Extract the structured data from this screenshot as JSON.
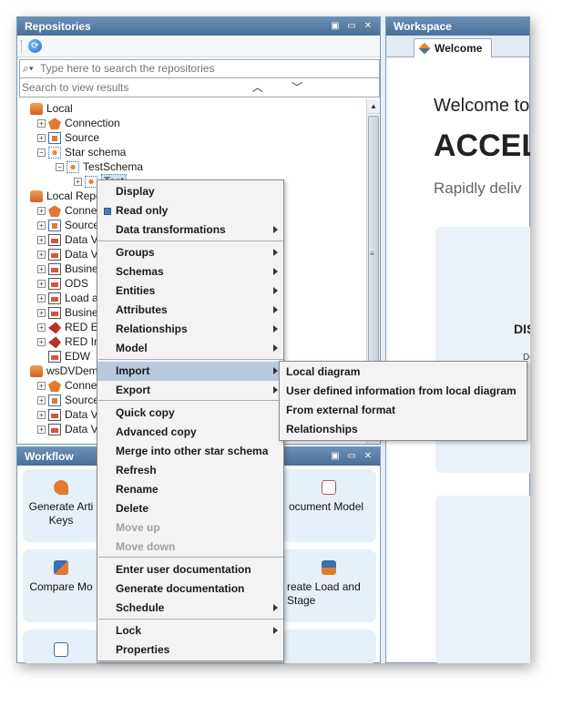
{
  "repositories": {
    "title": "Repositories",
    "controls": "▣ ▭ ✕",
    "search_placeholder": "Type here to search the repositories",
    "results_text": "Search to view results",
    "nav": "︿ ﹀",
    "tree": [
      {
        "label": "Local",
        "icon": "database-icon",
        "indent": 0,
        "exp": ""
      },
      {
        "label": "Connection",
        "icon": "connection-icon",
        "indent": 1,
        "exp": "+"
      },
      {
        "label": "Source",
        "icon": "source-icon",
        "indent": 1,
        "exp": "+"
      },
      {
        "label": "Star schema",
        "icon": "star-schema-icon",
        "indent": 1,
        "exp": "−"
      },
      {
        "label": "TestSchema",
        "icon": "star-schema-icon",
        "indent": 2,
        "exp": "−"
      },
      {
        "label": "Test",
        "icon": "star-schema-icon",
        "indent": 3,
        "exp": "+"
      },
      {
        "label": "Local Repos",
        "icon": "database-icon",
        "indent": 0,
        "exp": ""
      },
      {
        "label": "Connect",
        "icon": "connection-icon",
        "indent": 1,
        "exp": "+"
      },
      {
        "label": "Source",
        "icon": "source-icon",
        "indent": 1,
        "exp": "+"
      },
      {
        "label": "Data Vau",
        "icon": "document-icon",
        "indent": 1,
        "exp": "+"
      },
      {
        "label": "Data Vau",
        "icon": "document-icon",
        "indent": 1,
        "exp": "+"
      },
      {
        "label": "Busines",
        "icon": "document-icon",
        "indent": 1,
        "exp": "+"
      },
      {
        "label": "ODS",
        "icon": "document-icon",
        "indent": 1,
        "exp": "+"
      },
      {
        "label": "Load an",
        "icon": "document-icon",
        "indent": 1,
        "exp": "+"
      },
      {
        "label": "Busines",
        "icon": "document-icon",
        "indent": 1,
        "exp": "+"
      },
      {
        "label": "RED Exp",
        "icon": "red-export-icon",
        "indent": 1,
        "exp": "+"
      },
      {
        "label": "RED Imp",
        "icon": "red-import-icon",
        "indent": 1,
        "exp": "+"
      },
      {
        "label": "EDW",
        "icon": "document-icon",
        "indent": 1,
        "exp": ""
      },
      {
        "label": "wsDVDemo",
        "icon": "database-icon",
        "indent": 0,
        "exp": ""
      },
      {
        "label": "Connect",
        "icon": "connection-icon",
        "indent": 1,
        "exp": "+"
      },
      {
        "label": "Source",
        "icon": "source-icon",
        "indent": 1,
        "exp": "+"
      },
      {
        "label": "Data Vau",
        "icon": "document-icon",
        "indent": 1,
        "exp": "+"
      },
      {
        "label": "Data Vau",
        "icon": "document-icon",
        "indent": 1,
        "exp": "+"
      }
    ]
  },
  "workflow": {
    "title": "Workflow",
    "controls": "▣ ▭ ✕",
    "cards": [
      {
        "label": "Generate Arti Keys",
        "icon": "key-icon"
      },
      {
        "label": "ocument Model",
        "icon": "document-model-icon"
      },
      {
        "label": "Compare Mo",
        "icon": "compare-icon"
      },
      {
        "label": "reate Load and Stage",
        "icon": "load-stage-icon"
      },
      {
        "label": "",
        "icon": "copy-icon"
      }
    ]
  },
  "workspace": {
    "title": "Workspace",
    "tab_label": "Welcome",
    "welcome": "Welcome to",
    "accel": "ACCEL",
    "rapid": "Rapidly deliv",
    "dis": "DIS",
    "de": "De"
  },
  "context_menu": {
    "items": [
      {
        "label": "Display",
        "arrow": false,
        "disabled": false
      },
      {
        "label": "Read only",
        "arrow": false,
        "disabled": false,
        "check": true
      },
      {
        "label": "Data transformations",
        "arrow": true,
        "disabled": false
      },
      {
        "label": "Groups",
        "arrow": true,
        "disabled": false
      },
      {
        "label": "Schemas",
        "arrow": true,
        "disabled": false
      },
      {
        "label": "Entities",
        "arrow": true,
        "disabled": false
      },
      {
        "label": "Attributes",
        "arrow": true,
        "disabled": false
      },
      {
        "label": "Relationships",
        "arrow": true,
        "disabled": false
      },
      {
        "label": "Model",
        "arrow": true,
        "disabled": false
      },
      {
        "label": "Import",
        "arrow": true,
        "disabled": false,
        "highlighted": true
      },
      {
        "label": "Export",
        "arrow": true,
        "disabled": false
      },
      {
        "label": "Quick copy",
        "arrow": false,
        "disabled": false
      },
      {
        "label": "Advanced copy",
        "arrow": false,
        "disabled": false
      },
      {
        "label": "Merge into other star schema",
        "arrow": false,
        "disabled": false
      },
      {
        "label": "Refresh",
        "arrow": false,
        "disabled": false
      },
      {
        "label": "Rename",
        "arrow": false,
        "disabled": false
      },
      {
        "label": "Delete",
        "arrow": false,
        "disabled": false
      },
      {
        "label": "Move up",
        "arrow": false,
        "disabled": true
      },
      {
        "label": "Move down",
        "arrow": false,
        "disabled": true
      },
      {
        "label": "Enter user documentation",
        "arrow": false,
        "disabled": false
      },
      {
        "label": "Generate documentation",
        "arrow": false,
        "disabled": false
      },
      {
        "label": "Schedule",
        "arrow": true,
        "disabled": false
      },
      {
        "label": "Lock",
        "arrow": true,
        "disabled": false
      },
      {
        "label": "Properties",
        "arrow": false,
        "disabled": false
      }
    ],
    "submenu": [
      {
        "label": "Local diagram"
      },
      {
        "label": "User defined information from local diagram"
      },
      {
        "label": "From external format"
      },
      {
        "label": "Relationships"
      }
    ]
  }
}
